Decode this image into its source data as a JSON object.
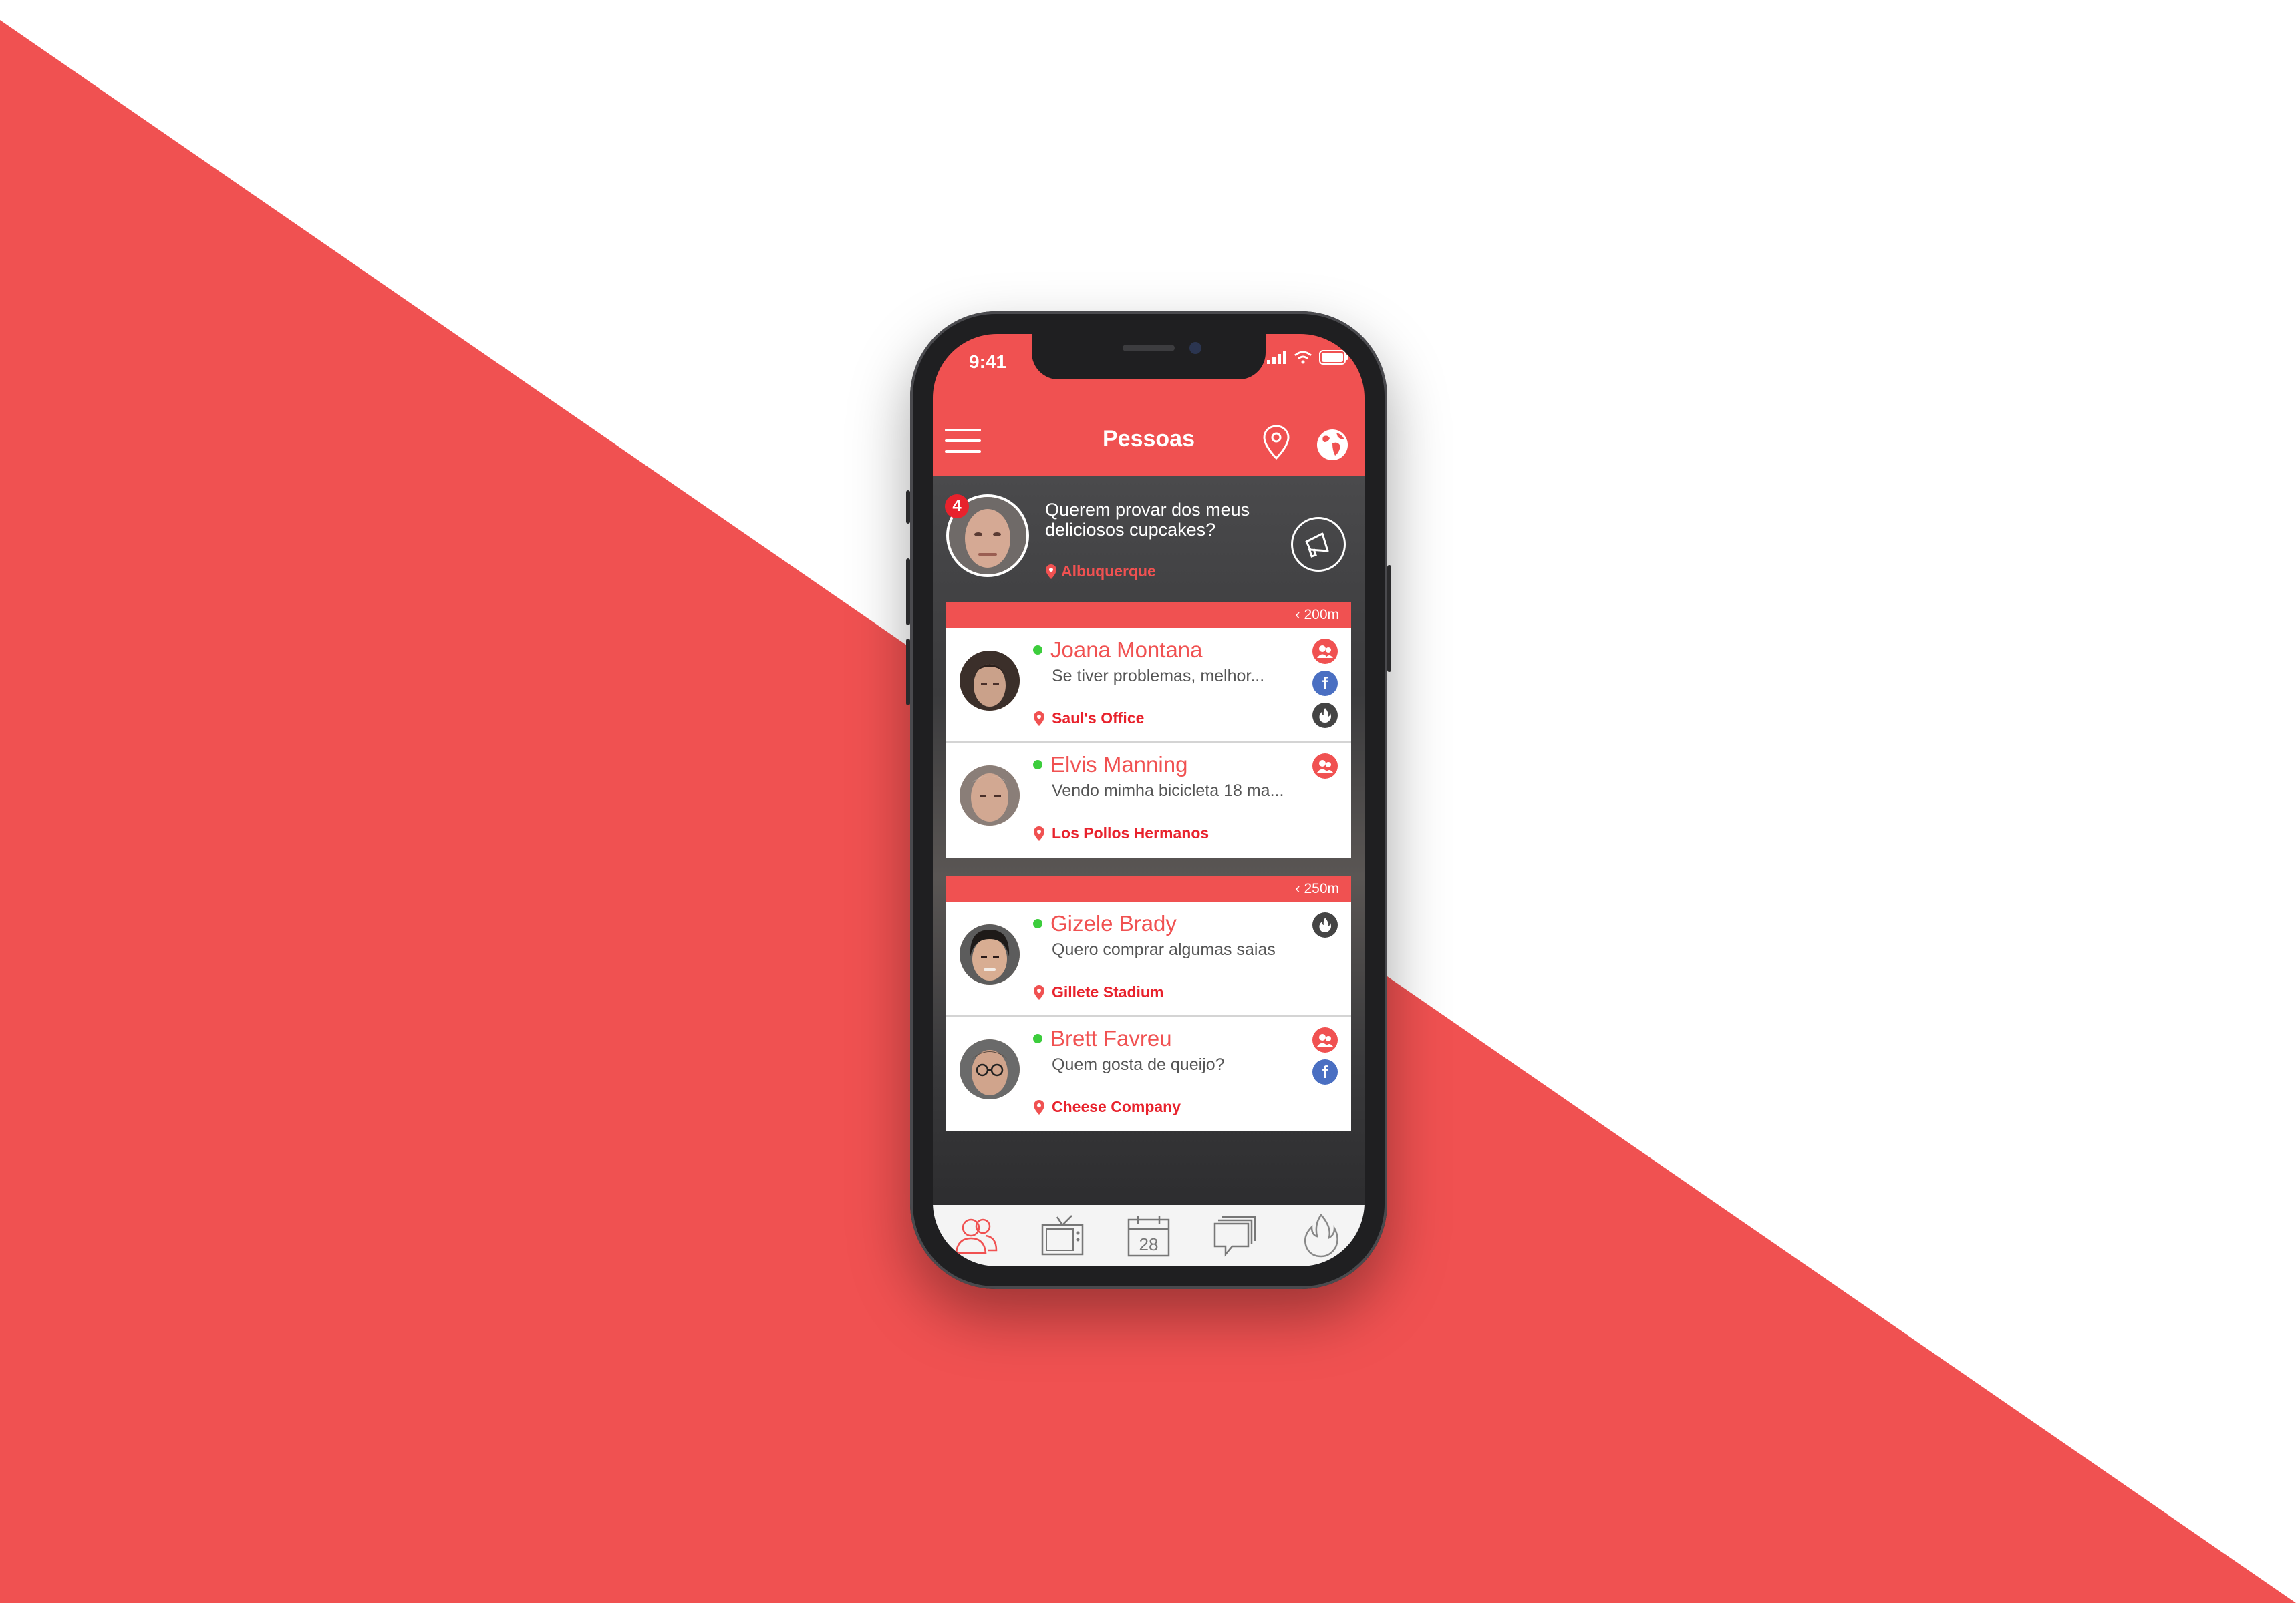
{
  "colors": {
    "accent": "#f05151",
    "online": "#3ccd3c",
    "facebook": "#4a6fc2",
    "dark_icon": "#444444"
  },
  "status_bar": {
    "time": "9:41",
    "icons": [
      "signal-icon",
      "wifi-icon",
      "battery-icon"
    ]
  },
  "header": {
    "title": "Pessoas",
    "left_icon": "menu-icon",
    "right_icons": [
      "location-pin-icon",
      "globe-icon"
    ]
  },
  "featured": {
    "badge": "4",
    "message": "Querem provar dos meus deliciosos cupcakes?",
    "location": "Albuquerque",
    "action_icon": "megaphone-icon"
  },
  "groups": [
    {
      "distance": "200m",
      "people": [
        {
          "name": "Joana Montana",
          "message": "Se tiver problemas, melhor...",
          "location": "Saul's Office",
          "online": true,
          "icons": [
            "friends-icon",
            "facebook-icon",
            "fire-icon"
          ]
        },
        {
          "name": "Elvis Manning",
          "message": "Vendo mimha bicicleta 18 ma...",
          "location": "Los Pollos Hermanos",
          "online": true,
          "icons": [
            "friends-icon"
          ]
        }
      ]
    },
    {
      "distance": "250m",
      "people": [
        {
          "name": "Gizele Brady",
          "message": "Quero comprar algumas saias",
          "location": "Gillete Stadium",
          "online": true,
          "icons": [
            "fire-icon"
          ]
        },
        {
          "name": "Brett Favreu",
          "message": "Quem gosta de queijo?",
          "location": "Cheese Company",
          "online": true,
          "icons": [
            "friends-icon",
            "facebook-icon"
          ]
        }
      ]
    }
  ],
  "tabbar": {
    "tabs": [
      {
        "icon": "people-icon",
        "active": true
      },
      {
        "icon": "tv-icon",
        "active": false
      },
      {
        "icon": "calendar-icon",
        "label": "28",
        "active": false
      },
      {
        "icon": "chat-icon",
        "active": false
      },
      {
        "icon": "fire-icon",
        "active": false
      }
    ]
  }
}
